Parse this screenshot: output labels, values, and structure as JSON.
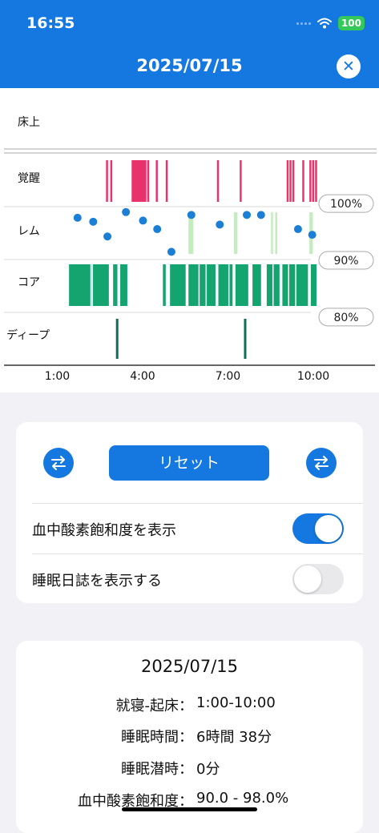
{
  "status_bar": {
    "time": "16:55",
    "battery": "100",
    "icons": [
      "signal-icon",
      "wifi-icon",
      "battery-icon"
    ]
  },
  "header": {
    "title": "2025/07/15",
    "close_icon": "close-icon"
  },
  "chart_data": {
    "type": "scatter",
    "title": "",
    "rows": [
      "床上",
      "覚醒",
      "レム",
      "コア",
      "ディープ"
    ],
    "x_ticks": [
      "1:00",
      "4:00",
      "7:00",
      "10:00"
    ],
    "xlim_hours": [
      0,
      10.5
    ],
    "spo2_ticks": [
      "100%",
      "90%",
      "80%"
    ],
    "spo2_range": [
      78,
      102
    ],
    "awake_marks": [
      2.6,
      2.75,
      3.5,
      3.55,
      3.6,
      3.65,
      3.7,
      3.75,
      3.8,
      3.85,
      3.9,
      3.95,
      4.05,
      4.35,
      4.7,
      6.5,
      7.3,
      8.95,
      9.05,
      9.15,
      9.5,
      9.75,
      9.85,
      9.95
    ],
    "rem_marks": [
      5.5,
      5.55,
      5.6,
      7.1,
      7.15,
      8.4,
      8.55,
      9.75,
      9.8
    ],
    "core_segments": [
      [
        1.3,
        2.7
      ],
      [
        2.85,
        3.0
      ],
      [
        3.1,
        3.35
      ],
      [
        4.6,
        4.7
      ],
      [
        4.85,
        5.4
      ],
      [
        5.5,
        6.45
      ],
      [
        6.55,
        7.05
      ],
      [
        7.15,
        7.6
      ],
      [
        7.75,
        8.05
      ],
      [
        8.25,
        8.7
      ],
      [
        8.8,
        9.7
      ],
      [
        9.8,
        10.0
      ]
    ],
    "deep_marks": [
      2.95,
      7.45
    ],
    "spo2_points": [
      [
        1.6,
        97.5
      ],
      [
        2.15,
        96.8
      ],
      [
        2.65,
        94.2
      ],
      [
        3.3,
        98.5
      ],
      [
        3.9,
        97.0
      ],
      [
        4.4,
        95.5
      ],
      [
        4.9,
        91.5
      ],
      [
        5.6,
        98.0
      ],
      [
        6.6,
        96.3
      ],
      [
        7.55,
        98.0
      ],
      [
        8.05,
        98.0
      ],
      [
        9.35,
        95.5
      ],
      [
        9.85,
        94.5
      ]
    ],
    "colors": {
      "awake": "#e8336d",
      "rem": "#c4ecbf",
      "core": "#14a46f",
      "deep": "#0f6e5a",
      "spo2": "#1b7fd6"
    }
  },
  "controls": {
    "reset_label": "リセット",
    "left_icon": "swap-arrows-icon",
    "right_icon": "swap-arrows-icon",
    "toggles": [
      {
        "label": "血中酸素飽和度を表示",
        "on": true
      },
      {
        "label": "睡眠日誌を表示する",
        "on": false
      }
    ]
  },
  "summary": {
    "date": "2025/07/15",
    "rows": [
      {
        "key": "就寝-起床：",
        "value": "1:00-10:00"
      },
      {
        "key": "睡眠時間：",
        "value": "6時間 38分"
      },
      {
        "key": "睡眠潜時：",
        "value": "0分"
      },
      {
        "key": "血中酸素飽和度：",
        "value": "90.0 - 98.0%"
      }
    ]
  }
}
